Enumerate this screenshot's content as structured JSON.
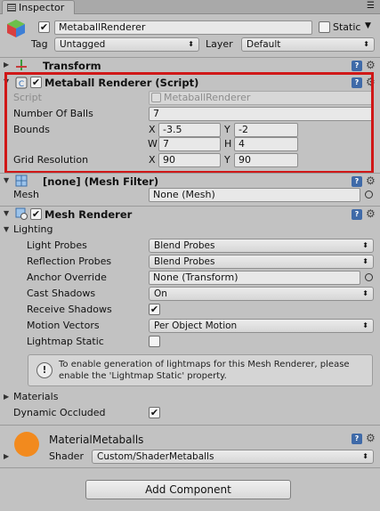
{
  "window": {
    "tab_title": "Inspector"
  },
  "object": {
    "name": "MetaballRenderer",
    "active": true,
    "static_label": "Static",
    "static_checked": false,
    "tag_label": "Tag",
    "tag_value": "Untagged",
    "layer_label": "Layer",
    "layer_value": "Default"
  },
  "transform": {
    "title": "Transform"
  },
  "metaball": {
    "title": "Metaball Renderer (Script)",
    "enabled": true,
    "script_label": "Script",
    "script_value": "MetaballRenderer",
    "num_balls_label": "Number Of Balls",
    "num_balls_value": "7",
    "bounds_label": "Bounds",
    "bounds": {
      "x_label": "X",
      "x": "-3.5",
      "y_label": "Y",
      "y": "-2",
      "w_label": "W",
      "w": "7",
      "h_label": "H",
      "h": "4"
    },
    "grid_label": "Grid Resolution",
    "grid": {
      "x_label": "X",
      "x": "90",
      "y_label": "Y",
      "y": "90"
    }
  },
  "mesh_filter": {
    "title": "[none] (Mesh Filter)",
    "mesh_label": "Mesh",
    "mesh_value": "None (Mesh)"
  },
  "mesh_renderer": {
    "title": "Mesh Renderer",
    "enabled": true,
    "lighting_label": "Lighting",
    "light_probes_label": "Light Probes",
    "light_probes_value": "Blend Probes",
    "reflection_probes_label": "Reflection Probes",
    "reflection_probes_value": "Blend Probes",
    "anchor_override_label": "Anchor Override",
    "anchor_override_value": "None (Transform)",
    "cast_shadows_label": "Cast Shadows",
    "cast_shadows_value": "On",
    "receive_shadows_label": "Receive Shadows",
    "receive_shadows_checked": true,
    "motion_vectors_label": "Motion Vectors",
    "motion_vectors_value": "Per Object Motion",
    "lightmap_static_label": "Lightmap Static",
    "lightmap_static_checked": false,
    "help_text": "To enable generation of lightmaps for this Mesh Renderer, please enable the 'Lightmap Static' property.",
    "materials_label": "Materials",
    "dynamic_occluded_label": "Dynamic Occluded",
    "dynamic_occluded_checked": true
  },
  "material": {
    "name": "MaterialMetaballs",
    "color": "#f28a1e",
    "shader_label": "Shader",
    "shader_value": "Custom/ShaderMetaballs"
  },
  "add_component_label": "Add Component",
  "colors": {
    "highlight": "#d01818",
    "help_icon": "#3f6aa8",
    "background": "#c2c2c2"
  },
  "icons": [
    "inspector-icon",
    "gameobject-cube-icon",
    "transform-icon",
    "script-icon",
    "mesh-filter-icon",
    "mesh-renderer-icon",
    "help-icon",
    "gear-icon",
    "info-icon",
    "object-picker-icon",
    "dropdown-arrow-icon",
    "foldout-arrow-icon"
  ]
}
